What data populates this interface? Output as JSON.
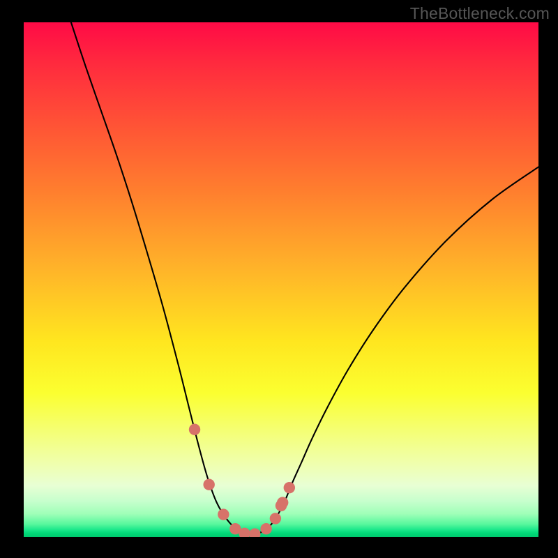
{
  "watermark": "TheBottleneck.com",
  "chart_data": {
    "type": "line",
    "title": "",
    "xlabel": "",
    "ylabel": "",
    "xlim": [
      0,
      100
    ],
    "ylim": [
      0,
      100
    ],
    "grid": false,
    "note": "No numeric axis ticks rendered; values below are normalized 0–100 from pixel positions of the plotted curve (y=0 at bottom, x=0 at left).",
    "series": [
      {
        "name": "curve",
        "x": [
          9.2,
          12,
          15,
          18,
          21,
          24,
          27,
          30,
          32,
          34,
          35.7,
          37.5,
          39.5,
          41.5,
          43.5,
          45.5,
          47,
          48.5,
          50.5,
          52.2,
          54,
          56,
          59,
          63,
          68,
          74,
          82,
          91,
          100
        ],
        "values": [
          100,
          91.5,
          82.9,
          74.3,
          65.1,
          55.2,
          44.9,
          33.6,
          25.6,
          17.7,
          11.6,
          6.7,
          3.4,
          1.4,
          0.5,
          0.7,
          1.5,
          3.0,
          6.5,
          10.6,
          14.6,
          19.1,
          25.2,
          32.5,
          40.4,
          48.5,
          57.5,
          65.6,
          71.9
        ]
      }
    ],
    "dots": {
      "name": "highlighted-points",
      "x": [
        33.2,
        36.0,
        38.8,
        41.1,
        42.9,
        44.9,
        47.1,
        48.9,
        50.0,
        50.3,
        51.6
      ],
      "values": [
        20.9,
        10.2,
        4.4,
        1.6,
        0.7,
        0.6,
        1.6,
        3.6,
        6.1,
        6.7,
        9.6
      ]
    }
  }
}
